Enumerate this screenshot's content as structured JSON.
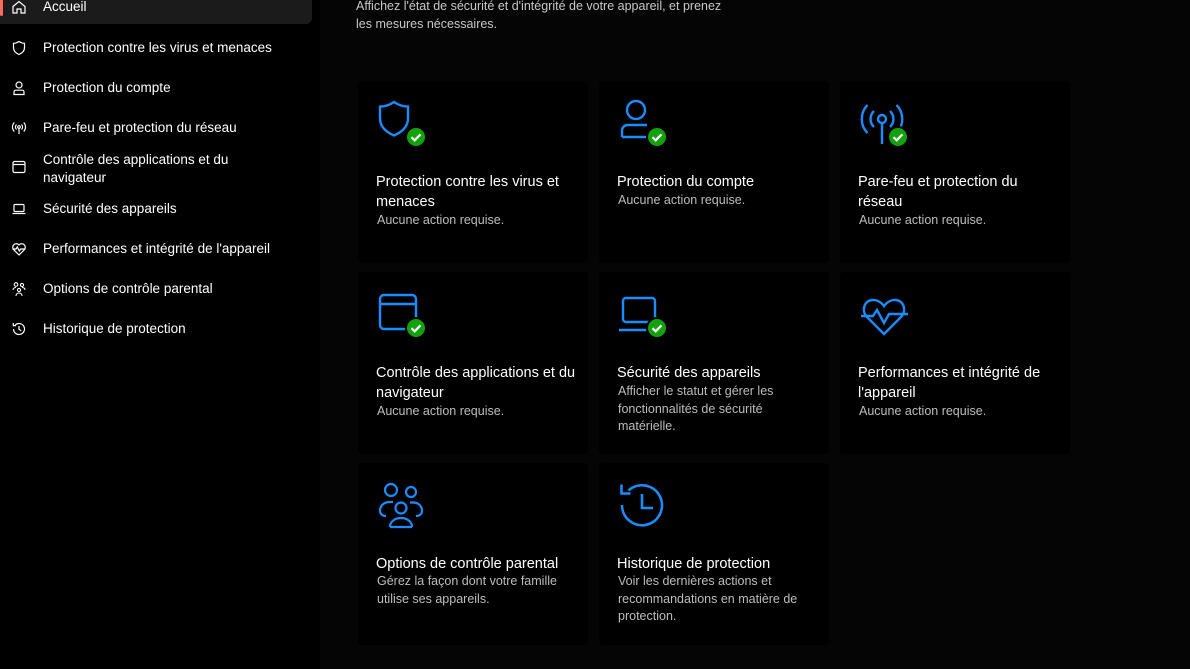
{
  "sidebar": {
    "items": [
      {
        "label": "Accueil",
        "icon": "home-icon"
      },
      {
        "label": "Protection contre les virus et menaces",
        "icon": "shield-icon"
      },
      {
        "label": "Protection du compte",
        "icon": "person-icon"
      },
      {
        "label": "Pare-feu et protection du réseau",
        "icon": "antenna-icon"
      },
      {
        "label": "Contrôle des applications et du navigateur",
        "icon": "app-window-icon"
      },
      {
        "label": "Sécurité des appareils",
        "icon": "laptop-icon"
      },
      {
        "label": "Performances et intégrité de l'appareil",
        "icon": "heart-pulse-icon"
      },
      {
        "label": "Options de contrôle parental",
        "icon": "family-icon"
      },
      {
        "label": "Historique de protection",
        "icon": "history-icon"
      }
    ]
  },
  "main": {
    "subtitle": "Affichez l'état de sécurité et d'intégrité de votre appareil, et prenez les mesures nécessaires.",
    "cards": [
      {
        "title": "Protection contre les virus et menaces",
        "desc": "Aucune action requise.",
        "icon": "shield-icon",
        "status": "ok"
      },
      {
        "title": "Protection du compte",
        "desc": "Aucune action requise.",
        "icon": "person-icon",
        "status": "ok"
      },
      {
        "title": "Pare-feu et protection du réseau",
        "desc": "Aucune action requise.",
        "icon": "antenna-icon",
        "status": "ok"
      },
      {
        "title": "Contrôle des applications et du navigateur",
        "desc": "Aucune action requise.",
        "icon": "app-window-icon",
        "status": "ok"
      },
      {
        "title": "Sécurité des appareils",
        "desc": "Afficher le statut et gérer les fonctionnalités de sécurité matérielle.",
        "icon": "laptop-icon",
        "status": "ok"
      },
      {
        "title": "Performances et intégrité de l'appareil",
        "desc": "Aucune action requise.",
        "icon": "heart-pulse-icon",
        "status": "none"
      },
      {
        "title": "Options de contrôle parental",
        "desc": "Gérez la façon dont votre famille utilise ses appareils.",
        "icon": "family-icon",
        "status": "none"
      },
      {
        "title": "Historique de protection",
        "desc": "Voir les dernières actions et recommandations en matière de protection.",
        "icon": "history-icon",
        "status": "none"
      }
    ]
  },
  "colors": {
    "accent_blue": "#1a8cff",
    "ok_green": "#13a10e",
    "active_marker": "#ff6a5c"
  }
}
